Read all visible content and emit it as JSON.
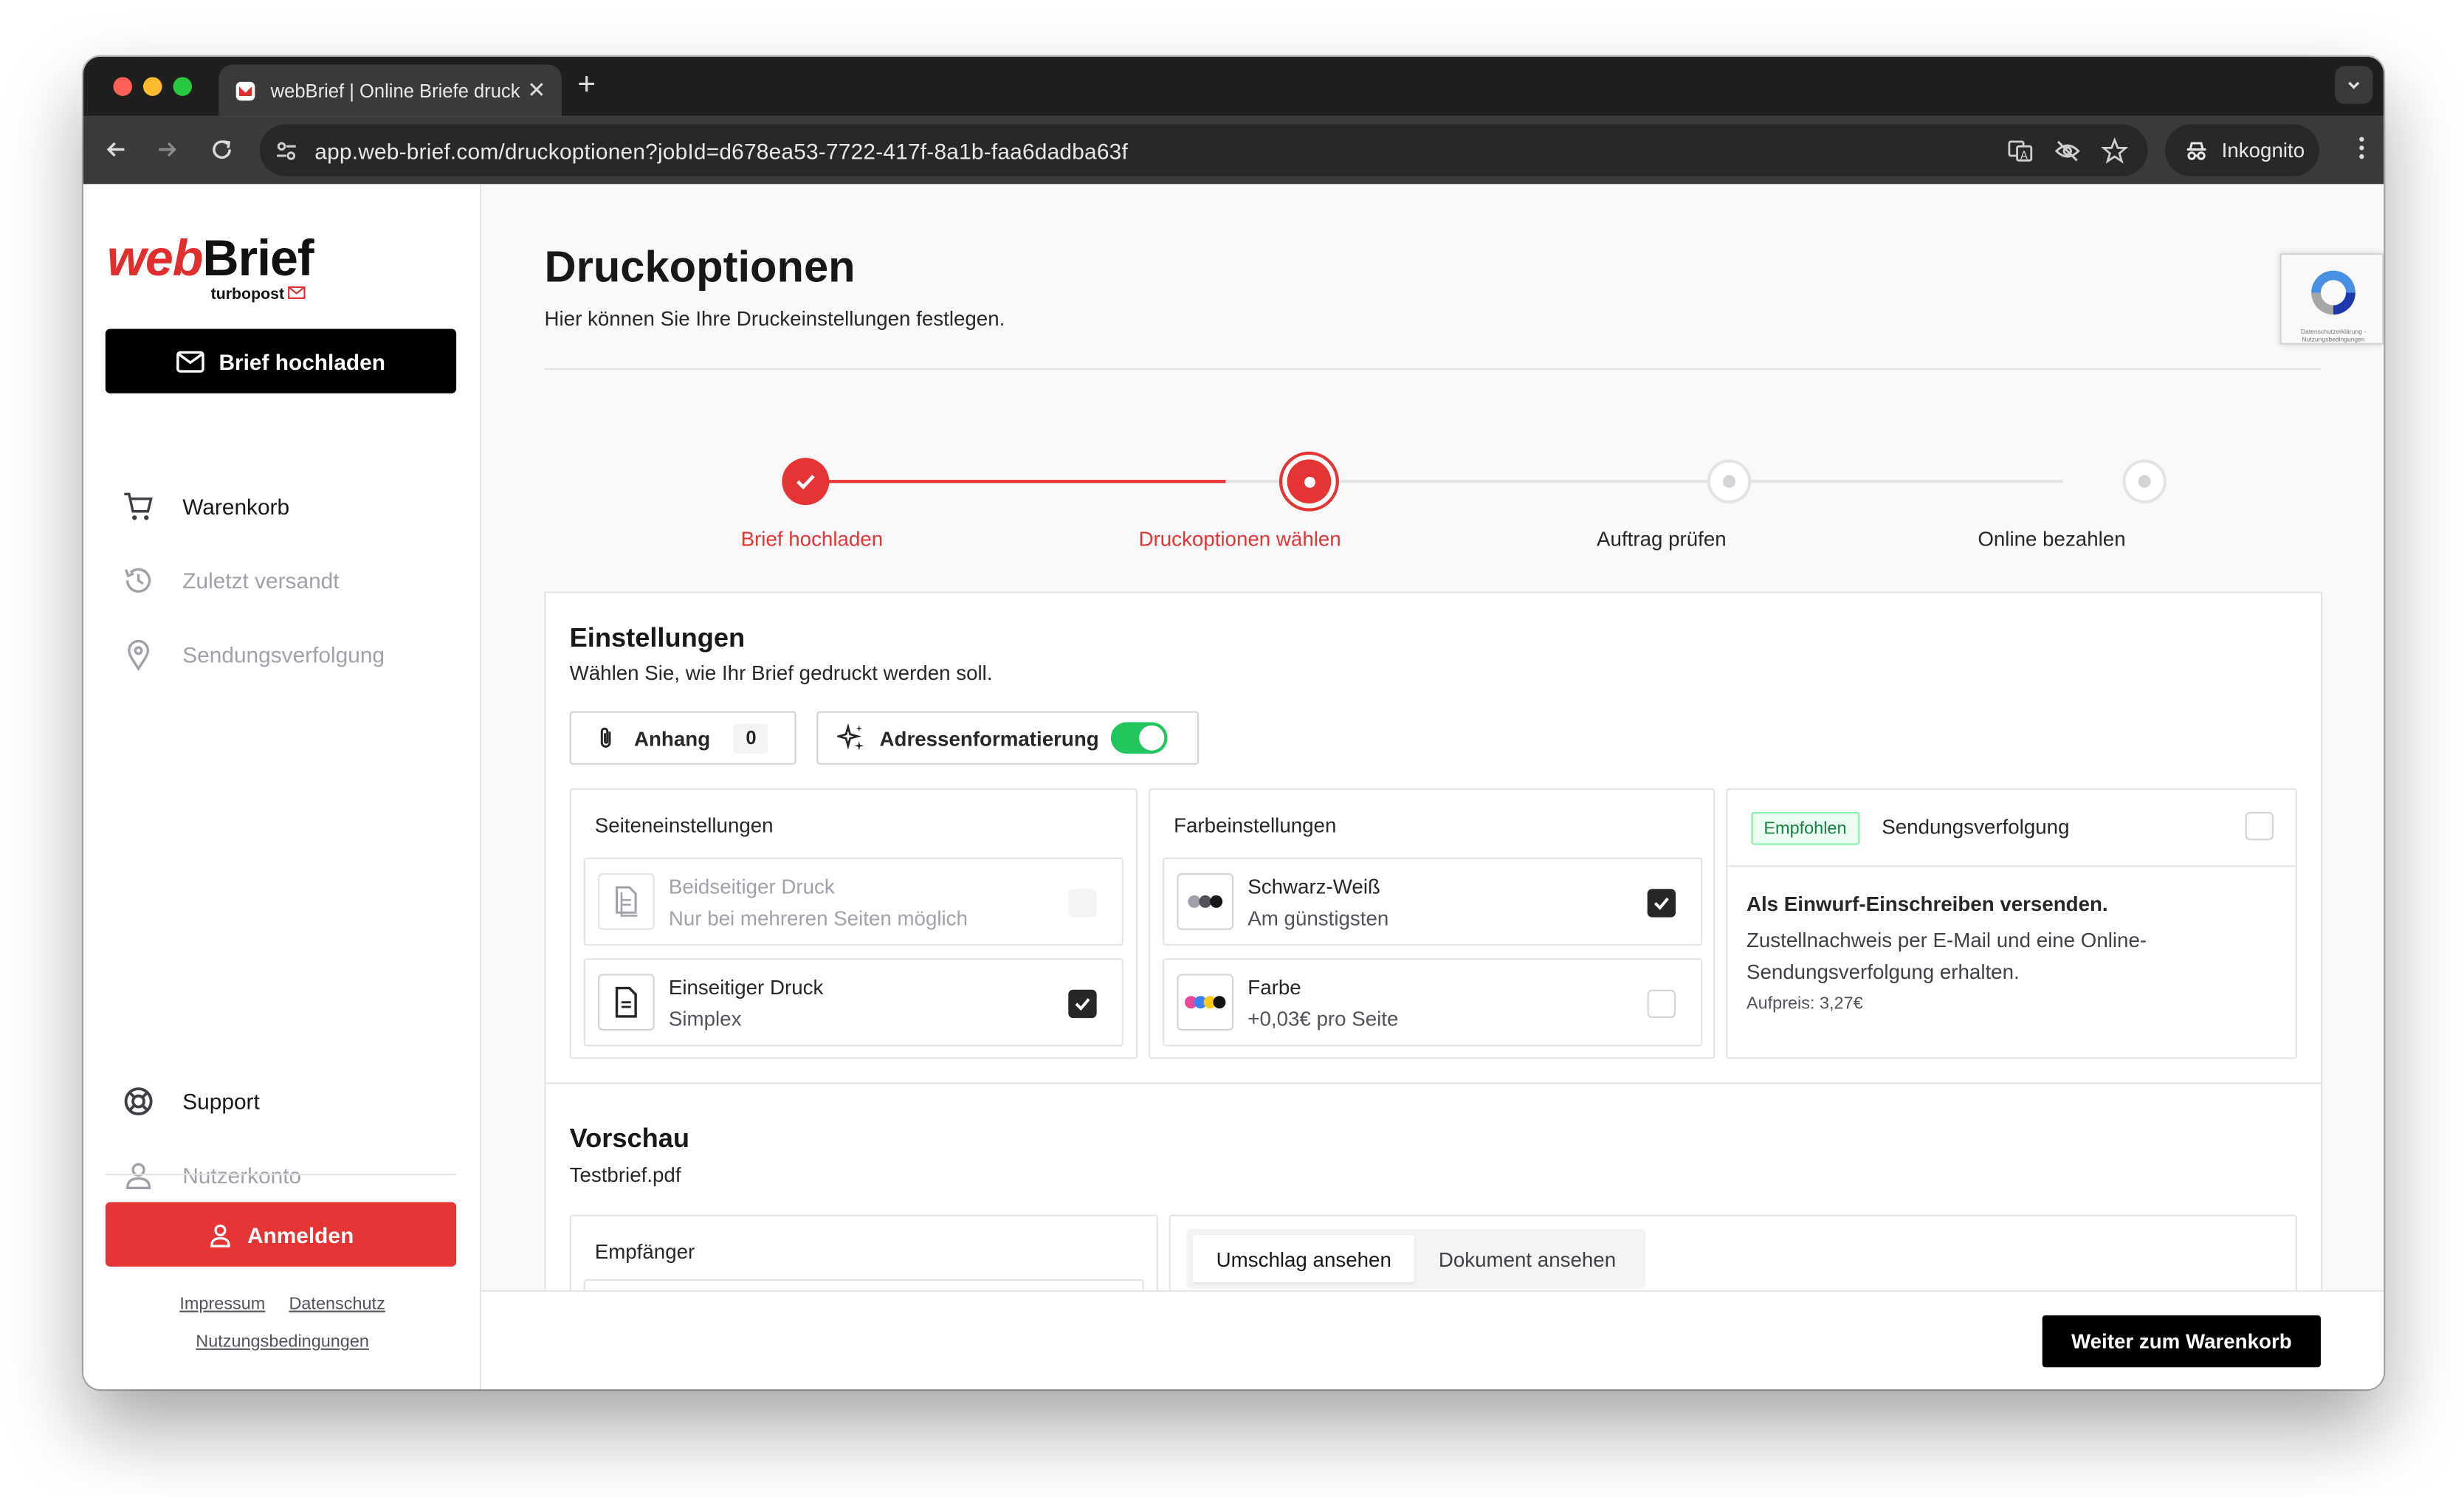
{
  "browser": {
    "tab_title": "webBrief | Online Briefe druck",
    "url": "app.web-brief.com/druckoptionen?jobId=d678ea53-7722-417f-8a1b-faa6dadba63f",
    "incognito_label": "Inkognito"
  },
  "sidebar": {
    "logo_web": "web",
    "logo_brief": "Brief",
    "logo_sub": "turbopost",
    "upload_button": "Brief hochladen",
    "nav": [
      {
        "label": "Warenkorb",
        "icon": "cart-icon"
      },
      {
        "label": "Zuletzt versandt",
        "icon": "history-icon"
      },
      {
        "label": "Sendungsverfolgung",
        "icon": "location-pin-icon"
      }
    ],
    "support": "Support",
    "account": "Nutzerkonto",
    "login_button": "Anmelden",
    "links": {
      "impressum": "Impressum",
      "datenschutz": "Datenschutz",
      "nutzung": "Nutzungsbedingungen"
    }
  },
  "main": {
    "title": "Druckoptionen",
    "subtitle": "Hier können Sie Ihre Druckeinstellungen festlegen.",
    "recaptcha_text": "Datenschutzerklärung - Nutzungsbedingungen",
    "steps": [
      {
        "label": "Brief hochladen",
        "state": "done"
      },
      {
        "label": "Druckoptionen wählen",
        "state": "active"
      },
      {
        "label": "Auftrag prüfen",
        "state": "pending"
      },
      {
        "label": "Online bezahlen",
        "state": "pending"
      }
    ],
    "settings": {
      "title": "Einstellungen",
      "subtitle": "Wählen Sie, wie Ihr Brief gedruckt werden soll.",
      "attachment_label": "Anhang",
      "attachment_count": "0",
      "address_format_label": "Adressenformatierung",
      "address_format_on": true,
      "page_settings": {
        "title": "Seiteneinstellungen",
        "options": [
          {
            "t1": "Beidseitiger Druck",
            "t2": "Nur bei mehreren Seiten möglich",
            "checked": false,
            "disabled": true
          },
          {
            "t1": "Einseitiger Druck",
            "t2": "Simplex",
            "checked": true,
            "disabled": false
          }
        ]
      },
      "color_settings": {
        "title": "Farbeinstellungen",
        "options": [
          {
            "t1": "Schwarz-Weiß",
            "t2": "Am günstigsten",
            "checked": true
          },
          {
            "t1": "Farbe",
            "t2": "+0,03€ pro Seite",
            "checked": false
          }
        ]
      },
      "tracking": {
        "badge": "Empfohlen",
        "title": "Sendungsverfolgung",
        "heading": "Als Einwurf-Einschreiben versenden.",
        "text": "Zustellnachweis per E-Mail und eine Online-Sendungsverfolgung erhalten.",
        "price": "Aufpreis: 3,27€"
      }
    },
    "preview": {
      "title": "Vorschau",
      "filename": "Testbrief.pdf",
      "recipient_label": "Empfänger",
      "tab_envelope": "Umschlag ansehen",
      "tab_document": "Dokument ansehen"
    },
    "next_button": "Weiter zum Warenkorb"
  },
  "colors": {
    "brand_red": "#e53434",
    "toggle_green": "#22c55e",
    "dark": "#000000"
  }
}
